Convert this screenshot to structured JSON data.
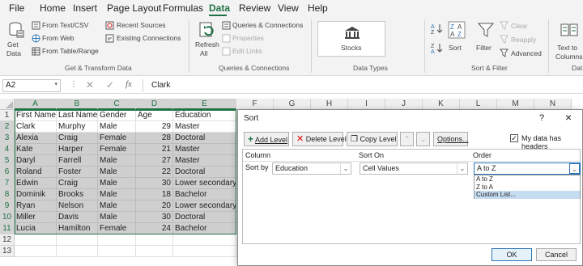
{
  "menu": {
    "items": [
      "File",
      "Home",
      "Insert",
      "Page Layout",
      "Formulas",
      "Data",
      "Review",
      "View",
      "Help"
    ],
    "active": "Data"
  },
  "ribbon": {
    "get_data_l1": "Get",
    "get_data_l2": "Data",
    "from_text_csv": "From Text/CSV",
    "from_web": "From Web",
    "from_table_range": "From Table/Range",
    "recent_sources": "Recent Sources",
    "existing_connections": "Existing Connections",
    "group_get_transform": "Get & Transform Data",
    "refresh_l1": "Refresh",
    "refresh_l2": "All",
    "queries_connections": "Queries & Connections",
    "properties": "Properties",
    "edit_links": "Edit Links",
    "group_queries": "Queries & Connections",
    "stocks": "Stocks",
    "group_data_types": "Data Types",
    "sort": "Sort",
    "filter": "Filter",
    "clear": "Clear",
    "reapply": "Reapply",
    "advanced": "Advanced",
    "group_sort_filter": "Sort & Filter",
    "text_to_l1": "Text to",
    "text_to_l2": "Columns",
    "group_data_tools": "Dat"
  },
  "formula_bar": {
    "name_box": "A2",
    "fx": "fx",
    "value": "Clark"
  },
  "grid": {
    "columns": [
      "A",
      "B",
      "C",
      "D",
      "E",
      "F",
      "G",
      "H",
      "I",
      "J",
      "K",
      "L",
      "M",
      "N"
    ],
    "rows": [
      [
        "First Name",
        "Last Name",
        "Gender",
        "Age",
        "Education"
      ],
      [
        "Clark",
        "Murphy",
        "Male",
        "29",
        "Master"
      ],
      [
        "Alexia",
        "Craig",
        "Female",
        "28",
        "Doctoral"
      ],
      [
        "Kate",
        "Harper",
        "Female",
        "21",
        "Master"
      ],
      [
        "Daryl",
        "Farrell",
        "Male",
        "27",
        "Master"
      ],
      [
        "Roland",
        "Foster",
        "Male",
        "22",
        "Doctoral"
      ],
      [
        "Edwin",
        "Craig",
        "Male",
        "30",
        "Lower secondary"
      ],
      [
        "Dominik",
        "Brooks",
        "Male",
        "18",
        "Bachelor"
      ],
      [
        "Ryan",
        "Nelson",
        "Male",
        "20",
        "Lower secondary"
      ],
      [
        "Miller",
        "Davis",
        "Male",
        "30",
        "Doctoral"
      ],
      [
        "Lucia",
        "Hamilton",
        "Female",
        "24",
        "Bachelor"
      ],
      [
        "",
        "",
        "",
        "",
        ""
      ],
      [
        "",
        "",
        "",
        "",
        ""
      ]
    ],
    "row_numbers": [
      "1",
      "2",
      "3",
      "4",
      "5",
      "6",
      "7",
      "8",
      "9",
      "10",
      "11",
      "12",
      "13"
    ]
  },
  "sort_dialog": {
    "title": "Sort",
    "help": "?",
    "close": "×",
    "add_level": "Add Level",
    "delete_level": "Delete Level",
    "copy_level": "Copy Level",
    "options": "Options...",
    "my_data_has_headers": "My data has headers",
    "headers_checked": true,
    "col_header_column": "Column",
    "col_header_sort_on": "Sort On",
    "col_header_order": "Order",
    "sort_by": "Sort by",
    "column_value": "Education",
    "sort_on_value": "Cell Values",
    "order_value": "A to Z",
    "order_options": [
      "A to Z",
      "Z to A",
      "Custom List..."
    ],
    "highlighted_option": "Custom List...",
    "ok": "OK",
    "cancel": "Cancel"
  },
  "colors": {
    "accent": "#217346",
    "selection": "#cfcfcf",
    "list_highlight": "#c5dcf1"
  }
}
